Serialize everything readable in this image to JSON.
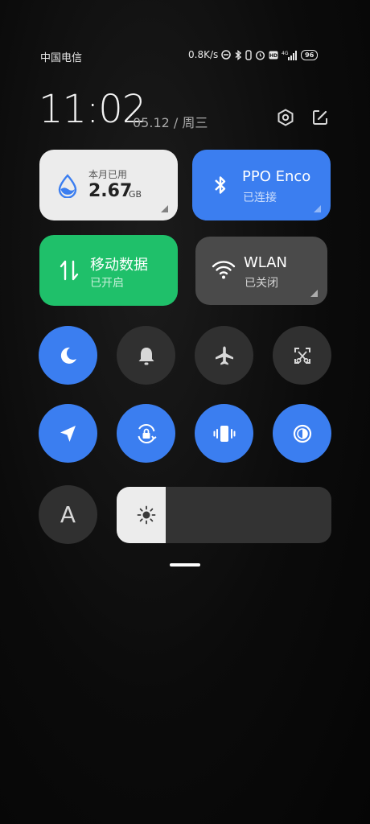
{
  "status_bar": {
    "carrier": "中国电信",
    "net_speed": "0.8K/s",
    "battery": "96"
  },
  "header": {
    "time": "11:02",
    "date": "05.12 / 周三"
  },
  "tiles": {
    "data_usage": {
      "label": "本月已用",
      "value": "2.67",
      "unit": "GB"
    },
    "bluetooth": {
      "title": "PPO Enco",
      "status": "已连接"
    },
    "mobile_data": {
      "title": "移动数据",
      "status": "已开启"
    },
    "wlan": {
      "title": "WLAN",
      "status": "已关闭"
    }
  },
  "toggles": [
    {
      "icon": "moon-icon",
      "state": "on"
    },
    {
      "icon": "bell-icon",
      "state": "off"
    },
    {
      "icon": "airplane-icon",
      "state": "off"
    },
    {
      "icon": "screenshot-icon",
      "state": "off"
    },
    {
      "icon": "location-icon",
      "state": "on"
    },
    {
      "icon": "rotation-lock-icon",
      "state": "on"
    },
    {
      "icon": "vibrate-icon",
      "state": "on"
    },
    {
      "icon": "invert-colors-icon",
      "state": "on"
    }
  ],
  "auto_brightness": {
    "label": "A"
  },
  "brightness": {
    "level_percent": 23
  },
  "colors": {
    "accent_blue": "#3b7ef0",
    "accent_green": "#1fc06a",
    "tile_light": "#ececec",
    "tile_dark": "#333333"
  }
}
